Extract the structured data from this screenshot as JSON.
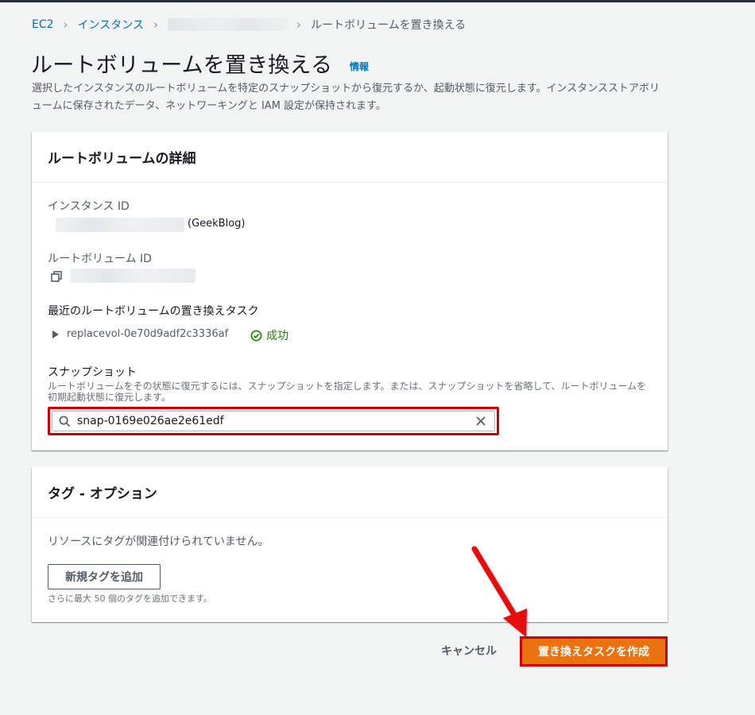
{
  "breadcrumb": {
    "ec2": "EC2",
    "instances": "インスタンス",
    "current": "ルートボリュームを置き換える"
  },
  "page": {
    "title": "ルートボリュームを置き換える",
    "info": "情報",
    "description": "選択したインスタンスのルートボリュームを特定のスナップショットから復元するか、起動状態に復元します。インスタンスストアボリュームに保存されたデータ、ネットワーキングと IAM 設定が保持されます。"
  },
  "details": {
    "header": "ルートボリュームの詳細",
    "instance_id_label": "インスタンス ID",
    "instance_name": "(GeekBlog)",
    "root_volume_id_label": "ルートボリューム ID",
    "recent_task_label": "最近のルートボリュームの置き換えタスク",
    "task_id": "replacevol-0e70d9adf2c3336af",
    "task_status": "成功",
    "snapshot_label": "スナップショット",
    "snapshot_hint": "ルートボリュームをその状態に復元するには、スナップショットを指定します。または、スナップショットを省略して、ルートボリュームを初期起動状態に復元します。",
    "snapshot_value": "snap-0169e026ae2e61edf"
  },
  "tags": {
    "header": "タグ - オプション",
    "empty_text": "リソースにタグが関連付けられていません。",
    "add_button": "新規タグを追加",
    "limit_hint": "さらに最大 50 個のタグを追加できます。"
  },
  "footer": {
    "cancel": "キャンセル",
    "create": "置き換えタスクを作成"
  },
  "colors": {
    "link": "#0073bb",
    "primary_button": "#ec7211",
    "highlight": "#d00000",
    "success": "#1d8102"
  }
}
